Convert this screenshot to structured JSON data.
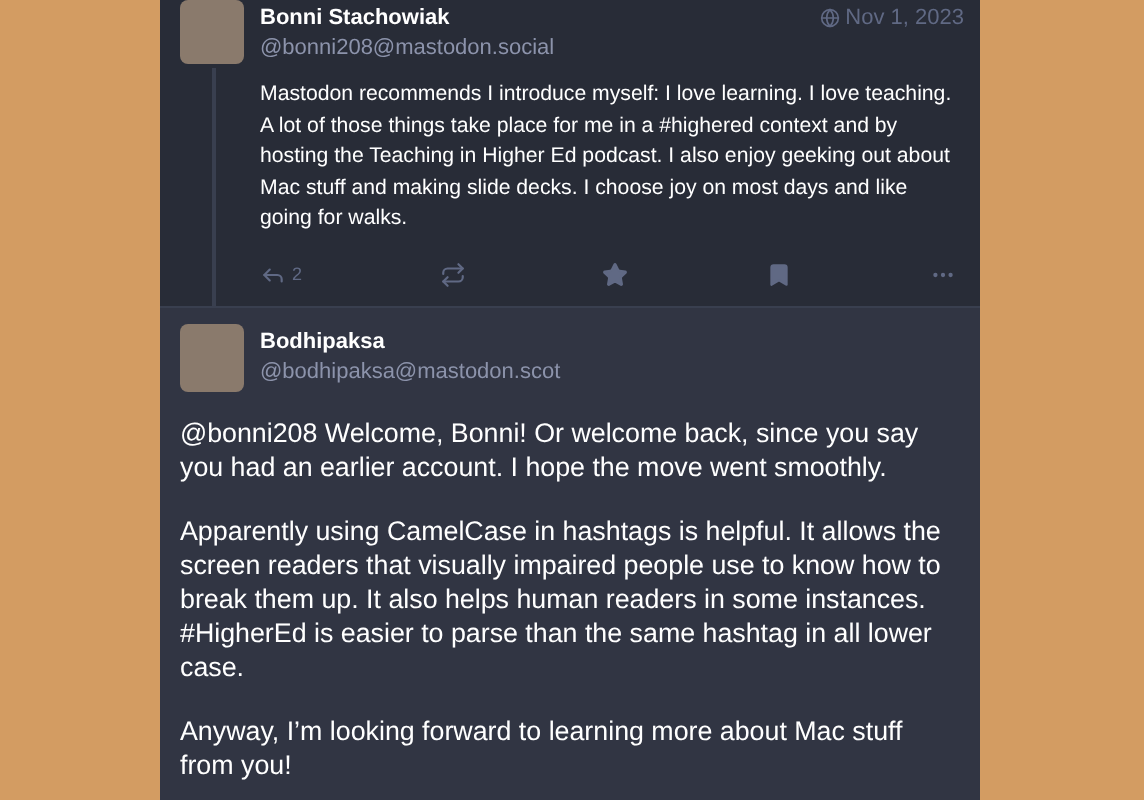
{
  "posts": [
    {
      "name": "Bonni Stachowiak",
      "handle": "@bonni208@mastodon.social",
      "date": "Nov 1, 2023",
      "paragraphs": [
        "Mastodon recommends I introduce myself: I love learning. I love teaching. A lot of those things take place for me in a #highered context and by hosting the Teaching in Higher Ed podcast. I also enjoy geeking out about Mac stuff and making slide decks. I choose joy on most days and like going for walks."
      ],
      "reply_count": "2",
      "kind": "compact"
    },
    {
      "name": "Bodhipaksa",
      "handle": "@bodhipaksa@mastodon.scot",
      "paragraphs": [
        "@bonni208 Welcome, Bonni! Or welcome back, since you say you had an earlier account. I hope the move went smoothly.",
        "Apparently using CamelCase in hashtags is helpful. It allows the screen readers that visually impaired people use to know how to break them up. It also helps human readers in some instances. #HigherEd is easier to parse than the same hashtag in all lower case.",
        "Anyway, I’m looking forward to learning more about Mac stuff from you!"
      ],
      "kind": "focused"
    }
  ]
}
